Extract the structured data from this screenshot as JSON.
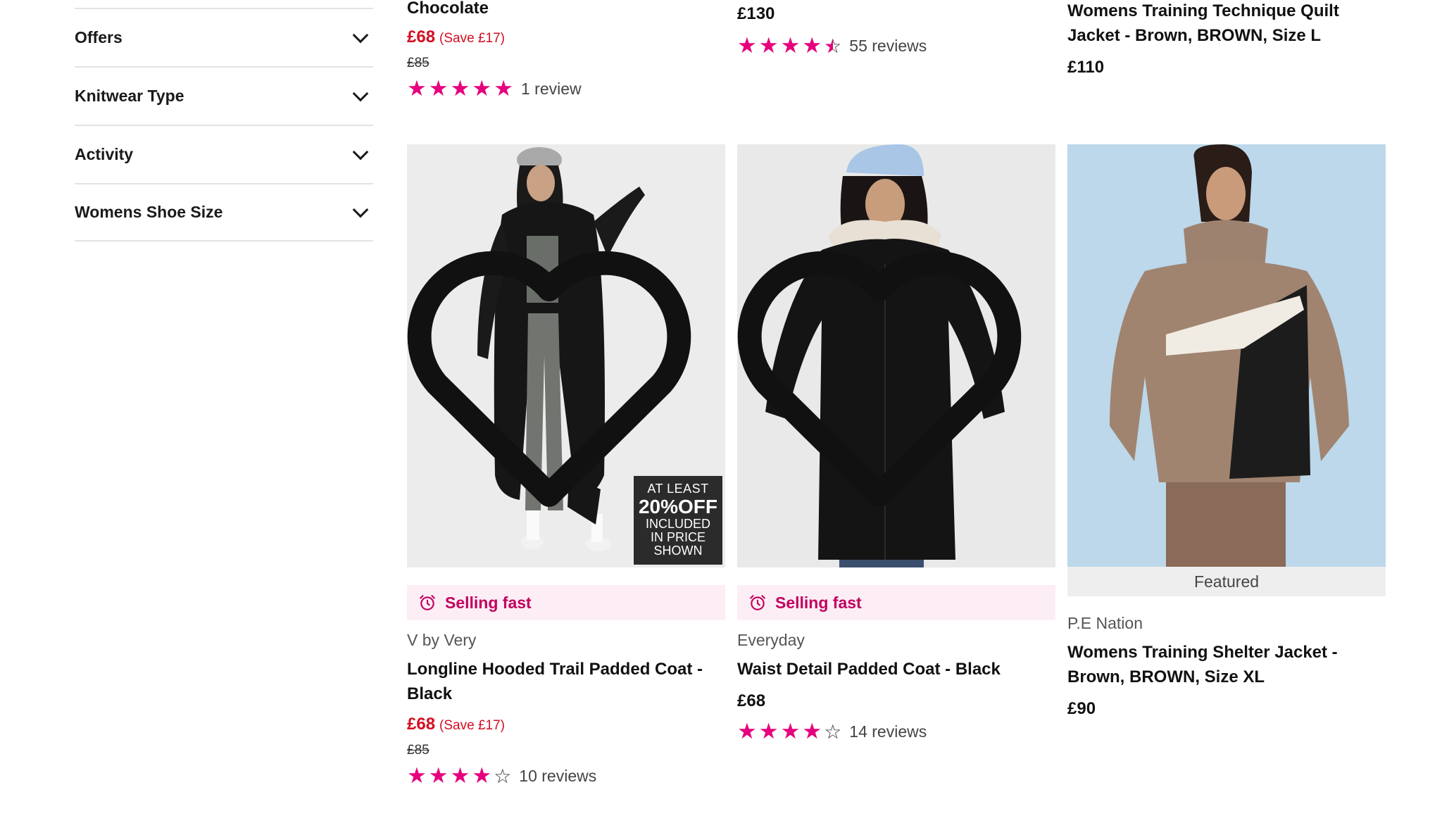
{
  "filters": [
    {
      "label": "Offers"
    },
    {
      "label": "Knitwear Type"
    },
    {
      "label": "Activity"
    },
    {
      "label": "Womens Shoe Size"
    }
  ],
  "top_row": {
    "p1": {
      "title": "Chocolate",
      "price": "£68",
      "save": "(Save £17)",
      "was": "£85",
      "reviews": "1 review",
      "rating": 5
    },
    "p2": {
      "price": "£130",
      "reviews": "55 reviews",
      "rating": 4.5
    },
    "p3": {
      "title": "Womens Training Technique Quilt Jacket - Brown, BROWN, Size L",
      "price": "£110"
    }
  },
  "products": [
    {
      "badge": "Selling fast",
      "brand": "V by Very",
      "title": "Longline Hooded Trail Padded Coat - Black",
      "price": "£68",
      "save": "(Save £17)",
      "was": "£85",
      "rating": 4,
      "reviews": "10 reviews",
      "promo": {
        "line1": "AT LEAST",
        "line2": "20%OFF",
        "line3": "INCLUDED",
        "line4": "IN PRICE",
        "line5": "SHOWN"
      }
    },
    {
      "badge": "Selling fast",
      "brand": "Everyday",
      "title": "Waist Detail Padded Coat - Black",
      "price": "£68",
      "rating": 4,
      "reviews": "14 reviews"
    },
    {
      "badge": "Featured",
      "brand": "P.E Nation",
      "title": "Womens Training Shelter Jacket - Brown, BROWN, Size XL",
      "price": "£90"
    }
  ],
  "icons": {
    "wishlist": "heart-icon",
    "selling_fast": "alarm-clock-icon",
    "filter_toggle": "chevron-down-icon"
  },
  "colors": {
    "accent_pink": "#e6007e",
    "sale_red": "#d40d21",
    "selling_fast_bg": "#fdeef6",
    "selling_fast_text": "#c2005f"
  }
}
